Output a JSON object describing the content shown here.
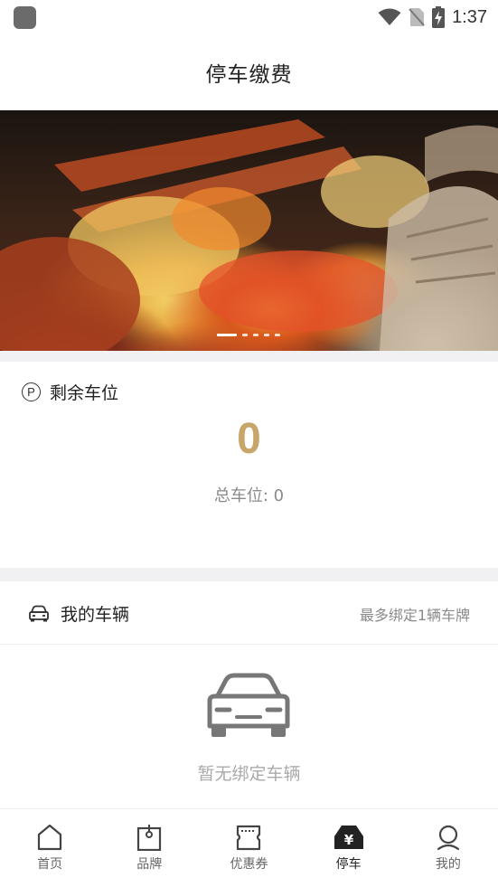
{
  "status_bar": {
    "time": "1:37",
    "icons": [
      "app-icon",
      "wifi-icon",
      "no-sim-icon",
      "battery-charging-icon"
    ]
  },
  "header": {
    "title": "停车缴费"
  },
  "banner": {
    "image": "crab-food-photo",
    "dot_count": 5,
    "active_dot": 1
  },
  "parking": {
    "icon": "parking-circle-icon",
    "icon_glyph": "P",
    "label": "剩余车位",
    "remaining": "0",
    "total_text": "总车位: 0",
    "accent_color": "#c8a56a"
  },
  "vehicle": {
    "icon": "car-outline-icon",
    "title": "我的车辆",
    "note": "最多绑定1辆车牌",
    "empty_icon": "car-front-icon",
    "empty_text": "暂无绑定车辆"
  },
  "tabbar": {
    "items": [
      {
        "label": "首页",
        "icon": "home-icon",
        "active": false
      },
      {
        "label": "品牌",
        "icon": "brand-tag-icon",
        "active": false
      },
      {
        "label": "优惠券",
        "icon": "coupon-icon",
        "active": false
      },
      {
        "label": "停车",
        "icon": "parking-payment-icon",
        "active": true
      },
      {
        "label": "我的",
        "icon": "profile-icon",
        "active": false
      }
    ]
  }
}
